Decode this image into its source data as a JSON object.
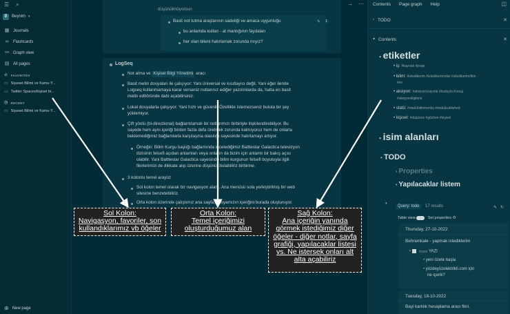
{
  "left": {
    "graph_name": "Beynim",
    "graph_badge": "B",
    "nav": [
      "Journals",
      "Flashcards",
      "Graph view",
      "All pages"
    ],
    "favorites_title": "FAVORITES",
    "favorites": [
      "Siyaset Bilimi ve Kamu Y...",
      "Twitter Spaces/kişisel bi..."
    ],
    "recent_title": "RECENT",
    "recent": [
      "Siyaset Bilimi ve Kamu Y..."
    ],
    "new_page": "New page"
  },
  "main": {
    "block1": {
      "top_cut": "düşünülmüyorsun",
      "line1": "Basit not tutma araçlarının sadeliği ve amaca uygunluğu",
      "line1_count": "1",
      "line2": "bu anlamda kullan - at mantığının faydaları",
      "line3": "her olan biteni hatırlamak zorunda mıyız?"
    },
    "block2": {
      "title": "LogSeq",
      "l1_a": "Not alma ve",
      "l1_b": "Kişisel Bilgi Yönetimi",
      "l1_c": "aracı",
      "l2": [
        "Basit metin dosyaları ile çalışıyor: Yani üniversal ve kısıtlayıcı değil. Yani eğer ileride",
        "Logseq kullanmamaya karar verseniz notlarınız ediğer yazılımlarda da, hatta en basit",
        "metin editöründe dahi açabilirsiniz."
      ],
      "l3": [
        "Lokal dosyalarla çalışıyor: Yani hızlı ve güvenli. Özellikle istemezseniz buluta bir şey",
        "yüklemiyor."
      ],
      "l4": [
        "Çift yönlü (bi-directional) bağlantılamalı bir notlarımızı birbiriyle ilişkilendirebiliyor. Bu",
        "sayede hem aynı içeriği birden fazla defa üretmek zorunda kalmıyoruz hem de onlarla",
        "beklemediğimiz bağlamlarla karşılaşma olasılığı sayesinde hatırlamayı artıyor."
      ],
      "l4sub": [
        "Örneğin: Bilim Kurgu başlığı bağlamında incelediğimiz Battlestar Galactica televizyon",
        "dizisinin felsefi açıdan anlamları veya onların da bizim için anlamlı bir bakış açısı",
        "olabilir. Yani Battlestar Galactica sayesinde bilim kurgunun felsefi boyutuyla ilgili",
        "fikirlerimizi de dikkate alıp üzerine düşünür bulabiliriz birbirine."
      ],
      "l5": "3 kolonlu temel arayüz",
      "l5a": [
        "Sol kolon temel olarak bir navigasyon alanı. Ana menüsü sola yerleştirilmiş bir web",
        "sitesine benzetebiliriz."
      ],
      "l5b": "Orta kolon üzerinde çalıştımız ana sayfa; dosyamızın içeriğini burada oluşturuyor."
    }
  },
  "right": {
    "tabs": [
      "Contents",
      "Page graph",
      "Help"
    ],
    "todo_header": "TODO",
    "contents_header": "Contents",
    "etiketler": "etiketler",
    "tag_rows": [
      {
        "k": "iş:",
        "v": "#kaynak #proje"
      },
      {
        "k": "bilim:",
        "v": "#izledikerim #izledikerim/dizi #izledikerim/film"
      },
      {
        "k": "",
        "v": "#ev"
      },
      {
        "k": "aksiyon:",
        "v": "#aksiyon/yayınla #kudayla Konuş"
      },
      {
        "k": "",
        "v": "#aksiyon/ilgilenir"
      },
      {
        "k": "statü:",
        "v": "#statü/bilinmemiş #statü/published"
      },
      {
        "k": "kişisel:",
        "v": "#düşünce #gözlem #kişisel"
      }
    ],
    "isim_alanlari": "isim alanları",
    "todo_title": "TODO",
    "properties": "Properties",
    "yapilacaklar": "Yapılacaklar listem",
    "query_label": "Query: todo",
    "query_count": "17 results",
    "table_view": "Table view",
    "set_properties": "Set properties",
    "card1_date": "Thursday, 27-10-2022",
    "card1_line": "Behramkale - yapmak istediklerim",
    "card1_todo": "TODO",
    "card1_todo_text": "YAZI",
    "card1_sub1": "yeni özete başla",
    "card1_sub2a": "yüzdeyüzelektrikli.com için",
    "card1_sub2b": "ne içerik?",
    "card2_date": "Tuesday, 18-10-2022",
    "card2_line": "Bayi karlılık hesaplama aracı fikri."
  },
  "callouts": {
    "left": [
      "Sol Kolon:",
      "Navigasyon, favoriler, son",
      "kullandıklarımız vb öğeler"
    ],
    "middle": [
      "Orta Kolon:",
      "Temel içeriğimizi",
      "oluşturduğumuz alan"
    ],
    "right": [
      "Sağ Kolon:",
      "Ana içeriğin yanında",
      "görmek istediğimiz diğer",
      "öğeler - diğer notlar, sayfa",
      "grafiği, yapılacaklar listesi",
      "vs. Ne istersek onları alt",
      "alta açabiliriz"
    ]
  }
}
